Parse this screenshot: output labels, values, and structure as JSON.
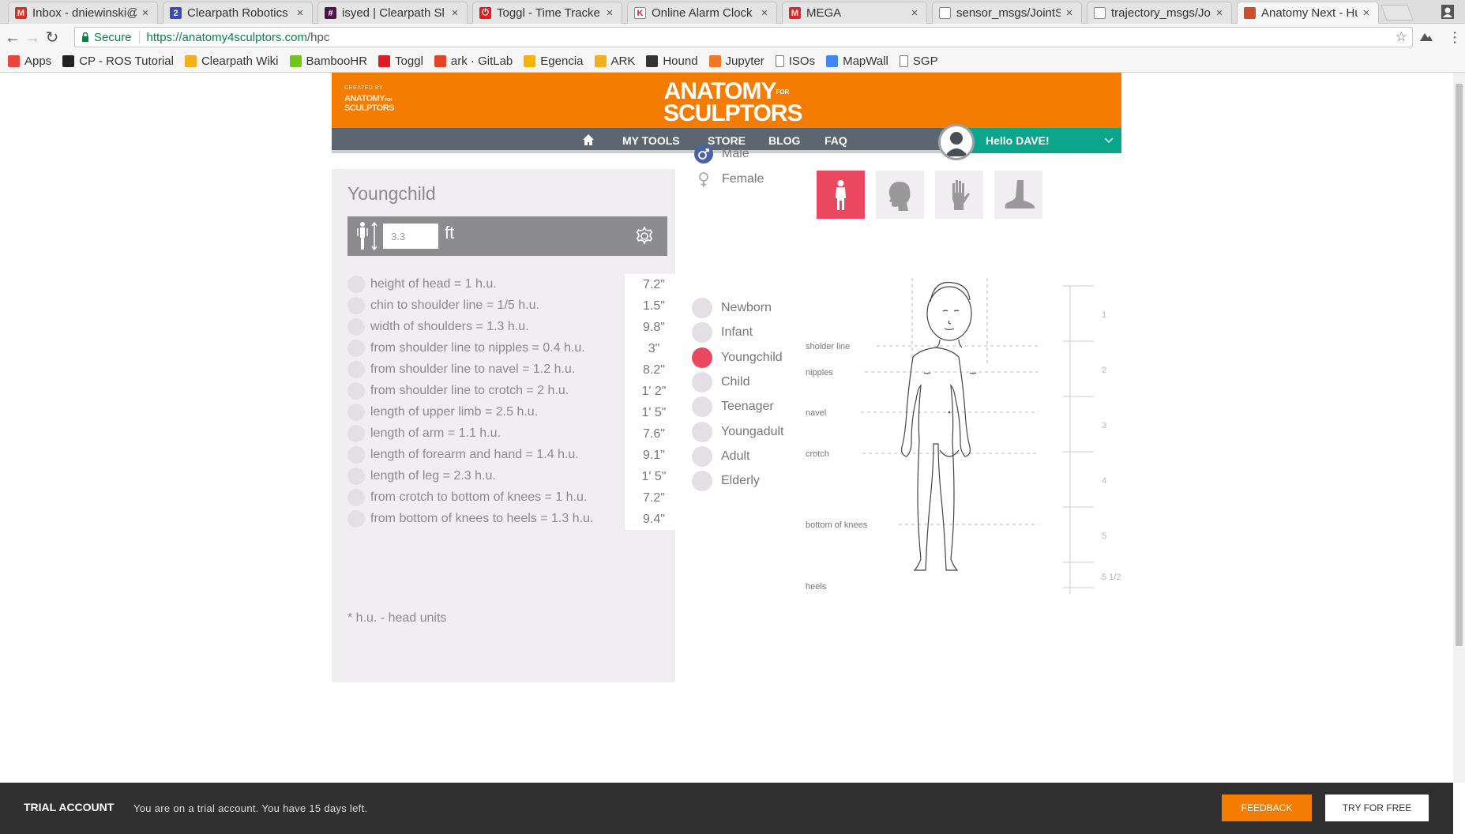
{
  "browser": {
    "tabs": [
      {
        "label": "Inbox - dniewinski@",
        "icon": "gmail-icon",
        "color": "#d93025",
        "glyph": "M"
      },
      {
        "label": "Clearpath Robotics",
        "icon": "clearpath-icon",
        "color": "#3b4bb8",
        "glyph": "2"
      },
      {
        "label": "isyed | Clearpath Sl",
        "icon": "slack-icon",
        "color": "#4a154b",
        "glyph": "#"
      },
      {
        "label": "Toggl - Time Tracke",
        "icon": "toggl-icon",
        "color": "#e01b22",
        "glyph": "⏻"
      },
      {
        "label": "Online Alarm Clock",
        "icon": "alarm-clock-icon",
        "color": "#ffffff",
        "glyph": "K"
      },
      {
        "label": "MEGA",
        "icon": "mega-icon",
        "color": "#d9272e",
        "glyph": "M"
      },
      {
        "label": "sensor_msgs/JointS",
        "icon": "document-icon",
        "color": "#ffffff",
        "glyph": ""
      },
      {
        "label": "trajectory_msgs/Jo",
        "icon": "document-icon",
        "color": "#ffffff",
        "glyph": ""
      },
      {
        "label": "Anatomy Next - Hum",
        "icon": "anatomy-next-icon",
        "color": "#c8502a",
        "glyph": ""
      }
    ],
    "secure_label": "Secure",
    "url_host": "https://anatomy4sculptors.com",
    "url_path": "/hpc",
    "bookmarks": [
      {
        "label": "Apps",
        "icon": "apps-grid-icon",
        "color": "#e8453c"
      },
      {
        "label": "CP - ROS Tutorial",
        "icon": "clearpath-icon",
        "color": "#222222"
      },
      {
        "label": "Clearpath Wiki",
        "icon": "wiki-icon",
        "color": "#f2b01e"
      },
      {
        "label": "BambooHR",
        "icon": "bamboohr-icon",
        "color": "#73c41d"
      },
      {
        "label": "Toggl",
        "icon": "toggl-icon",
        "color": "#e01b22"
      },
      {
        "label": "ark · GitLab",
        "icon": "gitlab-icon",
        "color": "#e24329"
      },
      {
        "label": "Egencia",
        "icon": "egencia-icon",
        "color": "#f5b400"
      },
      {
        "label": "ARK",
        "icon": "ark-icon",
        "color": "#f2b01e"
      },
      {
        "label": "Hound",
        "icon": "hound-icon",
        "color": "#333333"
      },
      {
        "label": "Jupyter",
        "icon": "jupyter-icon",
        "color": "#f37626"
      },
      {
        "label": "ISOs",
        "icon": "document-icon",
        "color": "#ffffff"
      },
      {
        "label": "MapWall",
        "icon": "google-icon",
        "color": "#4285f4"
      },
      {
        "label": "SGP",
        "icon": "document-icon",
        "color": "#ffffff"
      }
    ]
  },
  "site": {
    "created_by": "CREATED BY",
    "small_logo": [
      "ANATOMY",
      "SCULPTORS"
    ],
    "small_logo_for": "FOR",
    "logo_line1": "ANATOMY",
    "logo_for": "FOR",
    "logo_line2": "SCULPTORS",
    "brand_color": "#f47c00",
    "nav": {
      "links": [
        "MY TOOLS",
        "STORE",
        "BLOG",
        "FAQ"
      ],
      "greeting": "Hello DAVE!"
    }
  },
  "panel": {
    "title": "Youngchild",
    "height_value": "3.3",
    "height_unit": "ft",
    "measurements": [
      {
        "label": "height of head = 1 h.u.",
        "value": "7.2\""
      },
      {
        "label": "chin to shoulder line = 1/5 h.u.",
        "value": "1.5\""
      },
      {
        "label": "width of shoulders = 1.3 h.u.",
        "value": "9.8\""
      },
      {
        "label": "from shoulder line to nipples = 0.4 h.u.",
        "value": "3\""
      },
      {
        "label": "from shoulder line to navel = 1.2 h.u.",
        "value": "8.2\""
      },
      {
        "label": "from shoulder line to crotch = 2 h.u.",
        "value": "1' 2\""
      },
      {
        "label": "length of upper limb = 2.5 h.u.",
        "value": "1' 5\""
      },
      {
        "label": "length of arm = 1.1 h.u.",
        "value": "7.6\""
      },
      {
        "label": "length of forearm and hand = 1.4 h.u.",
        "value": "9.1\""
      },
      {
        "label": "length of leg = 2.3 h.u.",
        "value": "1' 5\""
      },
      {
        "label": "from crotch to bottom of knees = 1 h.u.",
        "value": "7.2\""
      },
      {
        "label": "from bottom of knees to heels = 1.3 h.u.",
        "value": "9.4\""
      }
    ],
    "footnote": "* h.u. - head units"
  },
  "gender": {
    "options": [
      {
        "label": "Male",
        "icon": "male-symbol-icon",
        "selected": true
      },
      {
        "label": "Female",
        "icon": "female-symbol-icon",
        "selected": false
      }
    ]
  },
  "body_parts": [
    {
      "name": "full-body",
      "icon": "full-body-icon",
      "selected": true
    },
    {
      "name": "head",
      "icon": "head-profile-icon",
      "selected": false
    },
    {
      "name": "hand",
      "icon": "hand-icon",
      "selected": false
    },
    {
      "name": "foot",
      "icon": "foot-icon",
      "selected": false
    }
  ],
  "ages": [
    {
      "label": "Newborn",
      "selected": false
    },
    {
      "label": "Infant",
      "selected": false
    },
    {
      "label": "Youngchild",
      "selected": true
    },
    {
      "label": "Child",
      "selected": false
    },
    {
      "label": "Teenager",
      "selected": false
    },
    {
      "label": "Youngadult",
      "selected": false
    },
    {
      "label": "Adult",
      "selected": false
    },
    {
      "label": "Elderly",
      "selected": false
    }
  ],
  "accent_color": "#ea4861",
  "diagram": {
    "line_labels": [
      "sholder line",
      "nipples",
      "navel",
      "crotch",
      "bottom of knees",
      "heels"
    ],
    "ruler_labels": [
      "1",
      "2",
      "3",
      "4",
      "5",
      "5 1/2"
    ]
  },
  "trial": {
    "title": "TRIAL ACCOUNT",
    "message": "You are on a trial account. You have 15 days left.",
    "feedback_label": "FEEDBACK",
    "try_label": "TRY FOR FREE"
  }
}
